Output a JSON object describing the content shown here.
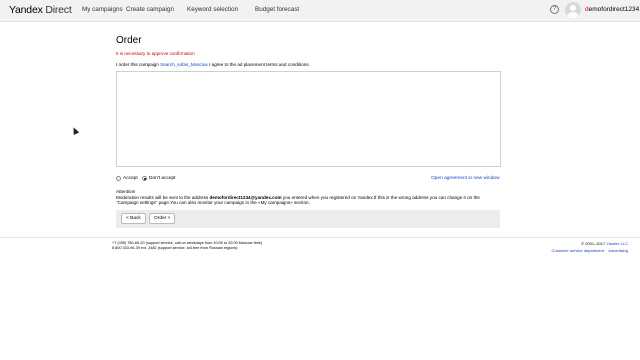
{
  "header": {
    "logo_yandex": "Yandex",
    "logo_direct": "Direct",
    "nav": [
      "My campaigns",
      "Create campaign",
      "Keyword selection",
      "Budget forecast"
    ],
    "help_glyph": "?",
    "user": {
      "first_letter": "d",
      "rest": "emofordirect1234"
    }
  },
  "main": {
    "title": "Order",
    "error": "It is necessary to approve confirmation",
    "agree_prefix": "I order this campaign",
    "campaign_name": "Search_sofas_Moscow",
    "agree_suffix": "I agree to the ad placement terms and conditions.",
    "radio_accept": "Accept",
    "radio_dont_accept": "Don't accept",
    "selected_radio": "dont_accept",
    "open_agreement": "Open agreement in new window",
    "attention_heading": "Attention!",
    "attention_text_1": "Moderation results will be sent to the address",
    "attention_email": "demofordirect1234@yandex.com",
    "attention_text_2": "you entered when you registered on Yandex.If this is the wrong address you can change it on the \"Campaign settings\" page.You can also monitor your campaign in the «My campaigns» section.",
    "back_button": "< Back",
    "order_button": "Order >"
  },
  "footer": {
    "phone_1": "+7 (495) 780-65-20 (support service, call on weekdays from 10:00 to 20:00 Moscow time)",
    "phone_2": "8 800 333-96-39 ext. 2482 (support service, toll-free from Russian regions)",
    "copyright": "© 2001–2017",
    "company": "Yandex LLC",
    "link_customer_service": "Customer service department",
    "link_advertising": "Advertising"
  }
}
